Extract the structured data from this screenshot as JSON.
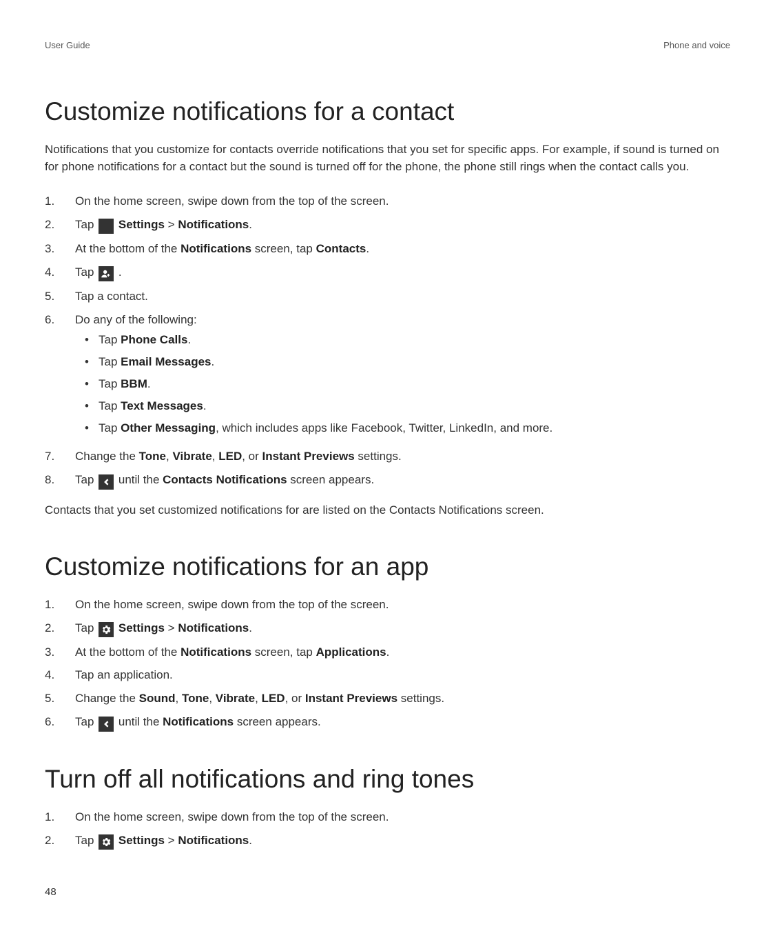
{
  "header": {
    "left": "User Guide",
    "right": "Phone and voice"
  },
  "page_number": "48",
  "sections": [
    {
      "title": "Customize notifications for a contact",
      "intro": "Notifications that you customize for contacts override notifications that you set for specific apps. For example, if sound is turned on for phone notifications for a contact but the sound is turned off for the phone, the phone still rings when the contact calls you.",
      "steps": {
        "s1": "On the home screen, swipe down from the top of the screen.",
        "s2_prefix": "Tap ",
        "s2_settings": "Settings",
        "s2_sep": " > ",
        "s2_notifications": "Notifications",
        "s2_suffix": ".",
        "s3_a": "At the bottom of the ",
        "s3_b": "Notifications",
        "s3_c": " screen, tap ",
        "s3_d": "Contacts",
        "s3_e": ".",
        "s4_prefix": "Tap ",
        "s4_suffix": " .",
        "s5": "Tap a contact.",
        "s6": "Do any of the following:",
        "s6_sub": {
          "a_pre": "Tap ",
          "a_b": "Phone Calls",
          "a_post": ".",
          "b_pre": "Tap ",
          "b_b": "Email Messages",
          "b_post": ".",
          "c_pre": "Tap ",
          "c_b": "BBM",
          "c_post": ".",
          "d_pre": "Tap ",
          "d_b": "Text Messages",
          "d_post": ".",
          "e_pre": "Tap ",
          "e_b": "Other Messaging",
          "e_post": ", which includes apps like Facebook, Twitter, LinkedIn, and more."
        },
        "s7_a": "Change the ",
        "s7_tone": "Tone",
        "s7_c1": ", ",
        "s7_vibrate": "Vibrate",
        "s7_c2": ", ",
        "s7_led": "LED",
        "s7_c3": ", or ",
        "s7_ip": "Instant Previews",
        "s7_end": " settings.",
        "s8_prefix": "Tap ",
        "s8_mid": " until the ",
        "s8_b": "Contacts Notifications",
        "s8_end": " screen appears."
      },
      "footnote": "Contacts that you set customized notifications for are listed on the Contacts Notifications screen."
    },
    {
      "title": "Customize notifications for an app",
      "steps": {
        "s1": "On the home screen, swipe down from the top of the screen.",
        "s2_prefix": "Tap ",
        "s2_settings": "Settings",
        "s2_sep": " > ",
        "s2_notifications": "Notifications",
        "s2_suffix": ".",
        "s3_a": "At the bottom of the ",
        "s3_b": "Notifications",
        "s3_c": " screen, tap ",
        "s3_d": "Applications",
        "s3_e": ".",
        "s4": "Tap an application.",
        "s5_a": "Change the ",
        "s5_sound": "Sound",
        "s5_c0": ", ",
        "s5_tone": "Tone",
        "s5_c1": ", ",
        "s5_vibrate": "Vibrate",
        "s5_c2": ", ",
        "s5_led": "LED",
        "s5_c3": ", or ",
        "s5_ip": "Instant Previews",
        "s5_end": " settings.",
        "s6_prefix": "Tap ",
        "s6_mid": " until the ",
        "s6_b": "Notifications",
        "s6_end": " screen appears."
      }
    },
    {
      "title": "Turn off all notifications and ring tones",
      "steps": {
        "s1": "On the home screen, swipe down from the top of the screen.",
        "s2_prefix": "Tap ",
        "s2_settings": "Settings",
        "s2_sep": " > ",
        "s2_notifications": "Notifications",
        "s2_suffix": "."
      }
    }
  ],
  "icons": {
    "settings": "gear-icon",
    "add_contact": "add-contact-icon",
    "back": "back-icon"
  }
}
